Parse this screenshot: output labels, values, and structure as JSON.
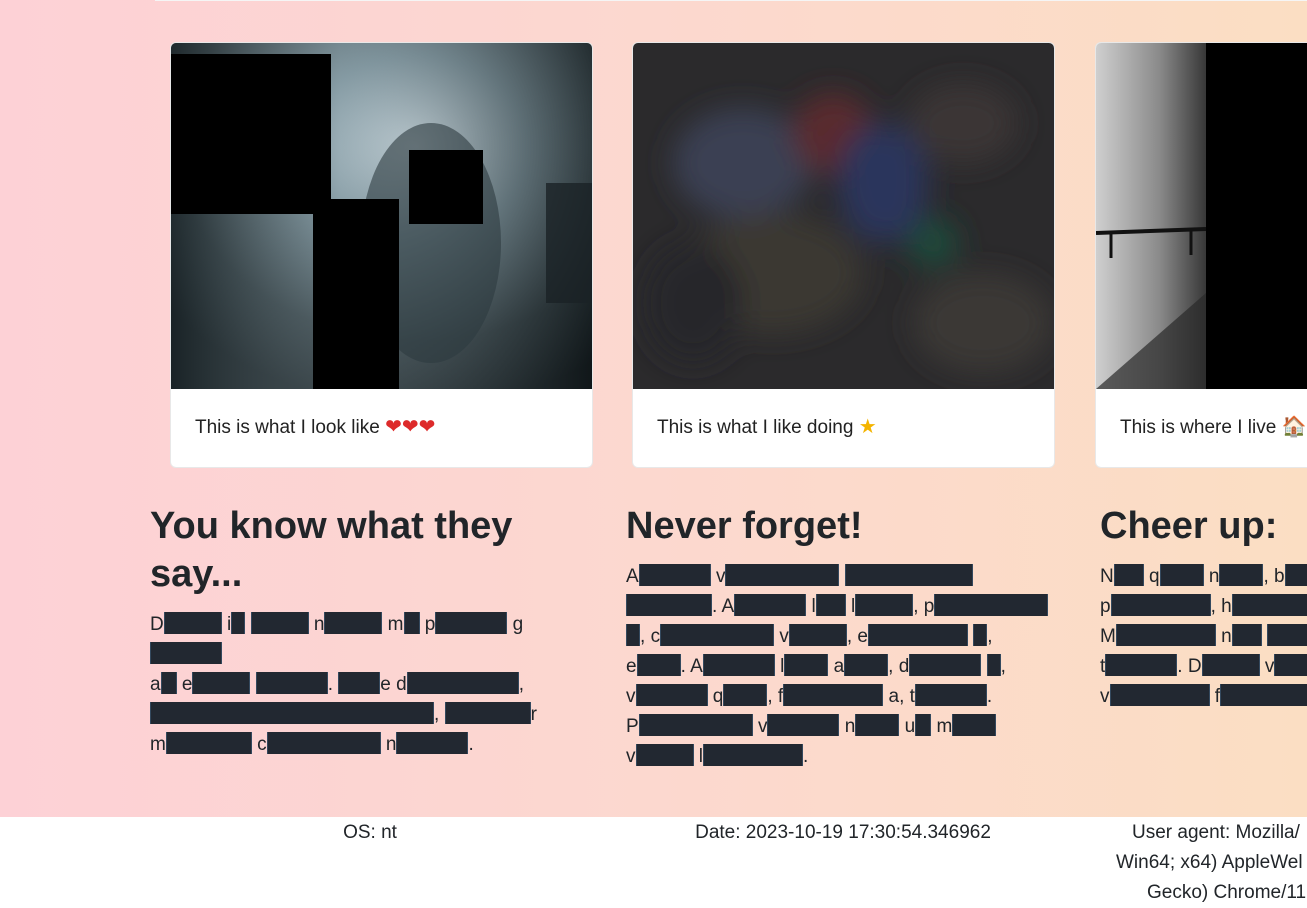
{
  "cards": [
    {
      "caption": "This is what I look like",
      "emojis": [
        "❤",
        "❤",
        "❤"
      ]
    },
    {
      "caption": "This is what I like doing",
      "emojis": [
        "★"
      ]
    },
    {
      "caption": "This is where I live",
      "emojis": [
        "🏠"
      ]
    }
  ],
  "sections": [
    {
      "title": "You know what they say...",
      "first_letters": [
        "D",
        "i",
        "",
        "n",
        "m",
        "p",
        "g",
        "a",
        "e",
        "",
        "",
        "d",
        "",
        "",
        "r",
        "m",
        "c",
        "n"
      ]
    },
    {
      "title": "Never forget!",
      "first_letters": [
        "A",
        "v",
        "",
        "",
        "A",
        "l",
        "l",
        "p",
        "",
        "c",
        "v",
        "e",
        "",
        "e",
        "A",
        "l",
        "a",
        "d",
        "",
        "v",
        "q",
        "f",
        "a",
        "t",
        "P",
        "v",
        "n",
        "u",
        "m",
        "v",
        "l"
      ]
    },
    {
      "title": "Cheer up:",
      "first_letters": [
        "N",
        "q",
        "n",
        "b",
        "p",
        "h",
        "M",
        "n",
        "t",
        "D",
        "v",
        "v",
        "f"
      ]
    }
  ],
  "footer": {
    "os": "OS: nt",
    "date": "Date: 2023-10-19 17:30:54.346962",
    "ua_line1": "User agent: Mozilla/",
    "ua_line2": "Win64; x64) AppleWel",
    "ua_line3": "Gecko) Chrome/11"
  },
  "colors": {
    "redaction": "#222831",
    "gradient_start": "#fdd1d6",
    "gradient_end": "#fbdec3"
  }
}
